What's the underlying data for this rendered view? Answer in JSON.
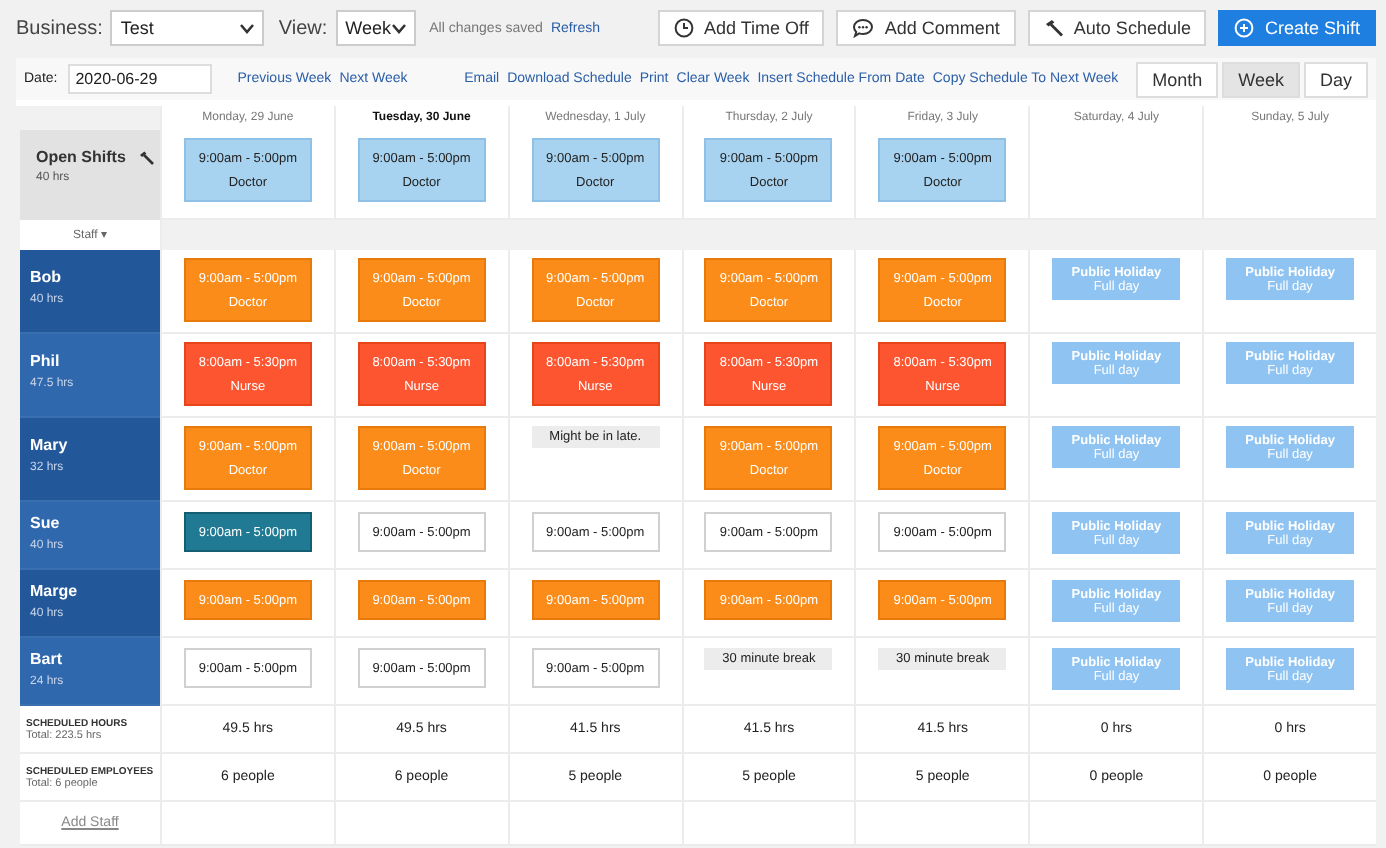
{
  "topbar": {
    "business_label": "Business:",
    "business": "Test",
    "view_label": "View:",
    "view": "Week",
    "status": "All changes saved",
    "refresh": "Refresh",
    "buttons": [
      {
        "kind": "time-off",
        "label": "Add Time Off"
      },
      {
        "kind": "comment",
        "label": "Add Comment"
      },
      {
        "kind": "auto",
        "label": "Auto Schedule"
      },
      {
        "kind": "create",
        "label": "Create Shift"
      }
    ]
  },
  "toolbar": {
    "date_label": "Date:",
    "date": "2020-06-29",
    "nav": [
      "Previous Week",
      "Next Week"
    ],
    "actions": [
      "Email",
      "Download Schedule",
      "Print",
      "Clear Week",
      "Insert Schedule From Date",
      "Copy Schedule To Next Week"
    ],
    "views": [
      {
        "label": "Month",
        "selected": false
      },
      {
        "label": "Week",
        "selected": true
      },
      {
        "label": "Day",
        "selected": false
      }
    ]
  },
  "days": [
    {
      "label": "Monday, 29 June",
      "today": false
    },
    {
      "label": "Tuesday, 30 June",
      "today": true
    },
    {
      "label": "Wednesday, 1 July",
      "today": false
    },
    {
      "label": "Thursday, 2 July",
      "today": false
    },
    {
      "label": "Friday, 3 July",
      "today": false
    },
    {
      "label": "Saturday, 4 July",
      "today": false
    },
    {
      "label": "Sunday, 5 July",
      "today": false
    }
  ],
  "open_shifts": {
    "title": "Open Shifts",
    "hours": "40 hrs",
    "cells": [
      {
        "kind": "open",
        "time": "9:00am - 5:00pm",
        "role": "Doctor"
      },
      {
        "kind": "open",
        "time": "9:00am - 5:00pm",
        "role": "Doctor"
      },
      {
        "kind": "open",
        "time": "9:00am - 5:00pm",
        "role": "Doctor"
      },
      {
        "kind": "open",
        "time": "9:00am - 5:00pm",
        "role": "Doctor"
      },
      {
        "kind": "open",
        "time": "9:00am - 5:00pm",
        "role": "Doctor"
      },
      {
        "kind": "none"
      },
      {
        "kind": "none"
      }
    ]
  },
  "staff_header": "Staff ▾",
  "staff": [
    {
      "name": "Bob",
      "hours": "40 hrs",
      "cells": [
        {
          "kind": "doctor",
          "time": "9:00am - 5:00pm",
          "role": "Doctor"
        },
        {
          "kind": "doctor",
          "time": "9:00am - 5:00pm",
          "role": "Doctor"
        },
        {
          "kind": "doctor",
          "time": "9:00am - 5:00pm",
          "role": "Doctor"
        },
        {
          "kind": "doctor",
          "time": "9:00am - 5:00pm",
          "role": "Doctor"
        },
        {
          "kind": "doctor",
          "time": "9:00am - 5:00pm",
          "role": "Doctor"
        },
        {
          "kind": "holiday",
          "title": "Public Holiday",
          "detail": "Full day"
        },
        {
          "kind": "holiday",
          "title": "Public Holiday",
          "detail": "Full day"
        }
      ]
    },
    {
      "name": "Phil",
      "hours": "47.5 hrs",
      "cells": [
        {
          "kind": "nurse",
          "time": "8:00am - 5:30pm",
          "role": "Nurse"
        },
        {
          "kind": "nurse",
          "time": "8:00am - 5:30pm",
          "role": "Nurse"
        },
        {
          "kind": "nurse",
          "time": "8:00am - 5:30pm",
          "role": "Nurse"
        },
        {
          "kind": "nurse",
          "time": "8:00am - 5:30pm",
          "role": "Nurse"
        },
        {
          "kind": "nurse",
          "time": "8:00am - 5:30pm",
          "role": "Nurse"
        },
        {
          "kind": "holiday",
          "title": "Public Holiday",
          "detail": "Full day"
        },
        {
          "kind": "holiday",
          "title": "Public Holiday",
          "detail": "Full day"
        }
      ]
    },
    {
      "name": "Mary",
      "hours": "32 hrs",
      "cells": [
        {
          "kind": "doctor",
          "time": "9:00am - 5:00pm",
          "role": "Doctor"
        },
        {
          "kind": "doctor",
          "time": "9:00am - 5:00pm",
          "role": "Doctor"
        },
        {
          "kind": "note",
          "text": "Might be in late."
        },
        {
          "kind": "doctor",
          "time": "9:00am - 5:00pm",
          "role": "Doctor"
        },
        {
          "kind": "doctor",
          "time": "9:00am - 5:00pm",
          "role": "Doctor"
        },
        {
          "kind": "holiday",
          "title": "Public Holiday",
          "detail": "Full day"
        },
        {
          "kind": "holiday",
          "title": "Public Holiday",
          "detail": "Full day"
        }
      ]
    },
    {
      "name": "Sue",
      "hours": "40 hrs",
      "cells": [
        {
          "kind": "highlight",
          "time": "9:00am - 5:00pm"
        },
        {
          "kind": "plain",
          "time": "9:00am - 5:00pm"
        },
        {
          "kind": "plain",
          "time": "9:00am - 5:00pm"
        },
        {
          "kind": "plain",
          "time": "9:00am - 5:00pm"
        },
        {
          "kind": "plain",
          "time": "9:00am - 5:00pm"
        },
        {
          "kind": "holiday",
          "title": "Public Holiday",
          "detail": "Full day"
        },
        {
          "kind": "holiday",
          "title": "Public Holiday",
          "detail": "Full day"
        }
      ]
    },
    {
      "name": "Marge",
      "hours": "40 hrs",
      "cells": [
        {
          "kind": "doctor",
          "time": "9:00am - 5:00pm"
        },
        {
          "kind": "doctor",
          "time": "9:00am - 5:00pm"
        },
        {
          "kind": "doctor",
          "time": "9:00am - 5:00pm"
        },
        {
          "kind": "doctor",
          "time": "9:00am - 5:00pm"
        },
        {
          "kind": "doctor",
          "time": "9:00am - 5:00pm"
        },
        {
          "kind": "holiday",
          "title": "Public Holiday",
          "detail": "Full day"
        },
        {
          "kind": "holiday",
          "title": "Public Holiday",
          "detail": "Full day"
        }
      ]
    },
    {
      "name": "Bart",
      "hours": "24 hrs",
      "cells": [
        {
          "kind": "plain",
          "time": "9:00am - 5:00pm"
        },
        {
          "kind": "plain",
          "time": "9:00am - 5:00pm"
        },
        {
          "kind": "plain",
          "time": "9:00am - 5:00pm"
        },
        {
          "kind": "note",
          "text": "30 minute break"
        },
        {
          "kind": "note",
          "text": "30 minute break"
        },
        {
          "kind": "holiday",
          "title": "Public Holiday",
          "detail": "Full day"
        },
        {
          "kind": "holiday",
          "title": "Public Holiday",
          "detail": "Full day"
        }
      ]
    }
  ],
  "summary": [
    {
      "title": "SCHEDULED HOURS",
      "total": "Total: 223.5 hrs",
      "values": [
        "49.5 hrs",
        "49.5 hrs",
        "41.5 hrs",
        "41.5 hrs",
        "41.5 hrs",
        "0 hrs",
        "0 hrs"
      ]
    },
    {
      "title": "SCHEDULED EMPLOYEES",
      "total": "Total: 6 people",
      "values": [
        "6 people",
        "6 people",
        "5 people",
        "5 people",
        "5 people",
        "0 people",
        "0 people"
      ]
    }
  ],
  "add_staff": "Add Staff"
}
